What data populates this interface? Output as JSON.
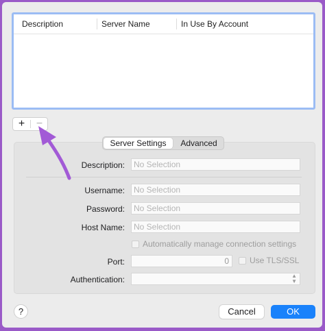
{
  "table": {
    "columns": [
      "Description",
      "Server Name",
      "In Use By Account"
    ],
    "rows": []
  },
  "toolbar": {
    "add_label": "+",
    "remove_label": "−"
  },
  "tabs": {
    "active": "Server Settings",
    "other": "Advanced"
  },
  "form": {
    "description": {
      "label": "Description:",
      "placeholder": "No Selection"
    },
    "username": {
      "label": "Username:",
      "placeholder": "No Selection"
    },
    "password": {
      "label": "Password:",
      "placeholder": "No Selection"
    },
    "host_name": {
      "label": "Host Name:",
      "placeholder": "No Selection"
    },
    "auto_manage_label": "Automatically manage connection settings",
    "port": {
      "label": "Port:",
      "value": "0"
    },
    "tls_label": "Use TLS/SSL",
    "authentication": {
      "label": "Authentication:",
      "value": ""
    }
  },
  "footer": {
    "help": "?",
    "cancel": "Cancel",
    "ok": "OK"
  },
  "colors": {
    "accent": "#1a82fb",
    "annotation": "#a25ad6",
    "table_focus": "#9bbcf4"
  }
}
